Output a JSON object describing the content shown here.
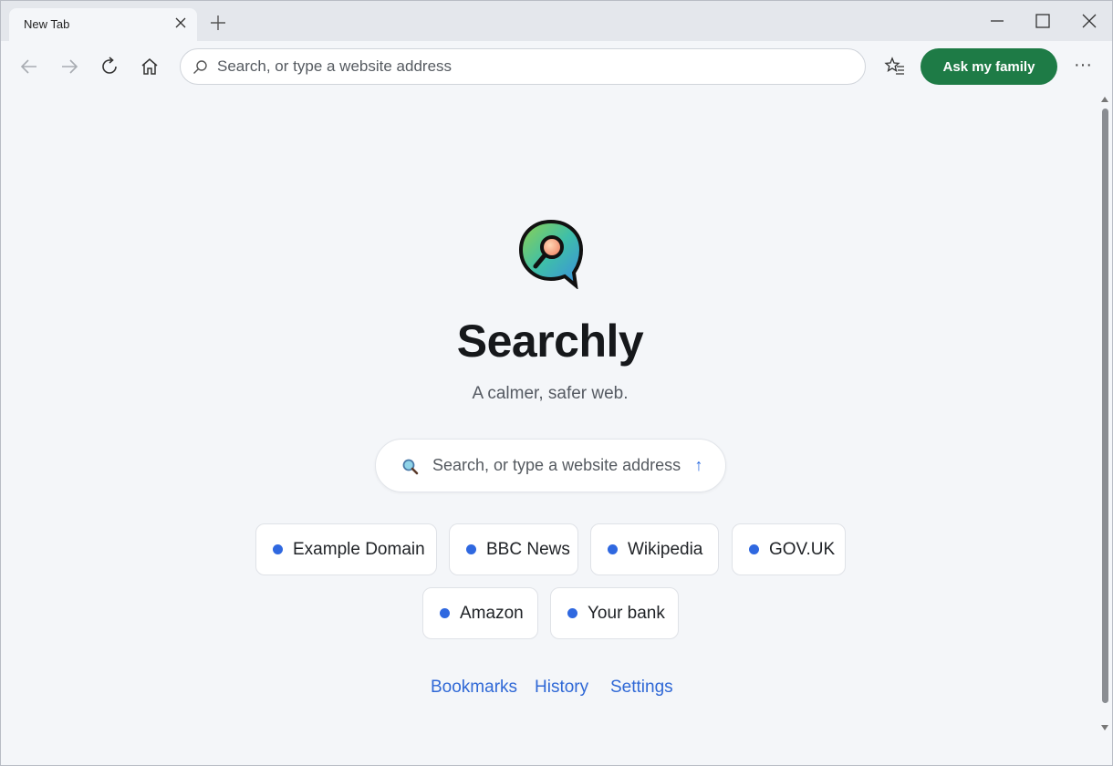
{
  "window": {
    "tab_title": "New Tab"
  },
  "toolbar": {
    "address_placeholder": "Search, or type a website address",
    "ask_label": "Ask my family",
    "more_label": "···"
  },
  "main": {
    "brand": "Searchly",
    "tagline": "A calmer, safer web.",
    "search_placeholder": "Search, or type a website address",
    "submit_label": "↑",
    "shortcuts": [
      {
        "label": "Example Domain"
      },
      {
        "label": "BBC News"
      },
      {
        "label": "Wikipedia"
      },
      {
        "label": "GOV.UK"
      },
      {
        "label": "Amazon"
      },
      {
        "label": "Your bank"
      }
    ],
    "links": [
      {
        "label": "Bookmarks"
      },
      {
        "label": "History"
      },
      {
        "label": "Settings"
      }
    ]
  },
  "colors": {
    "accent_green": "#1e7b46",
    "link_blue": "#2f68d6",
    "dot_blue": "#2f68e0"
  },
  "icons": {
    "tab_close": "close-icon",
    "new_tab": "plus-icon",
    "back": "arrow-left-icon",
    "forward": "arrow-right-icon",
    "reload": "reload-icon",
    "home": "home-icon",
    "address_search": "search-icon",
    "favorites": "favorites-icon",
    "logo": "searchly-logo-icon",
    "search": "magnifier-icon"
  }
}
